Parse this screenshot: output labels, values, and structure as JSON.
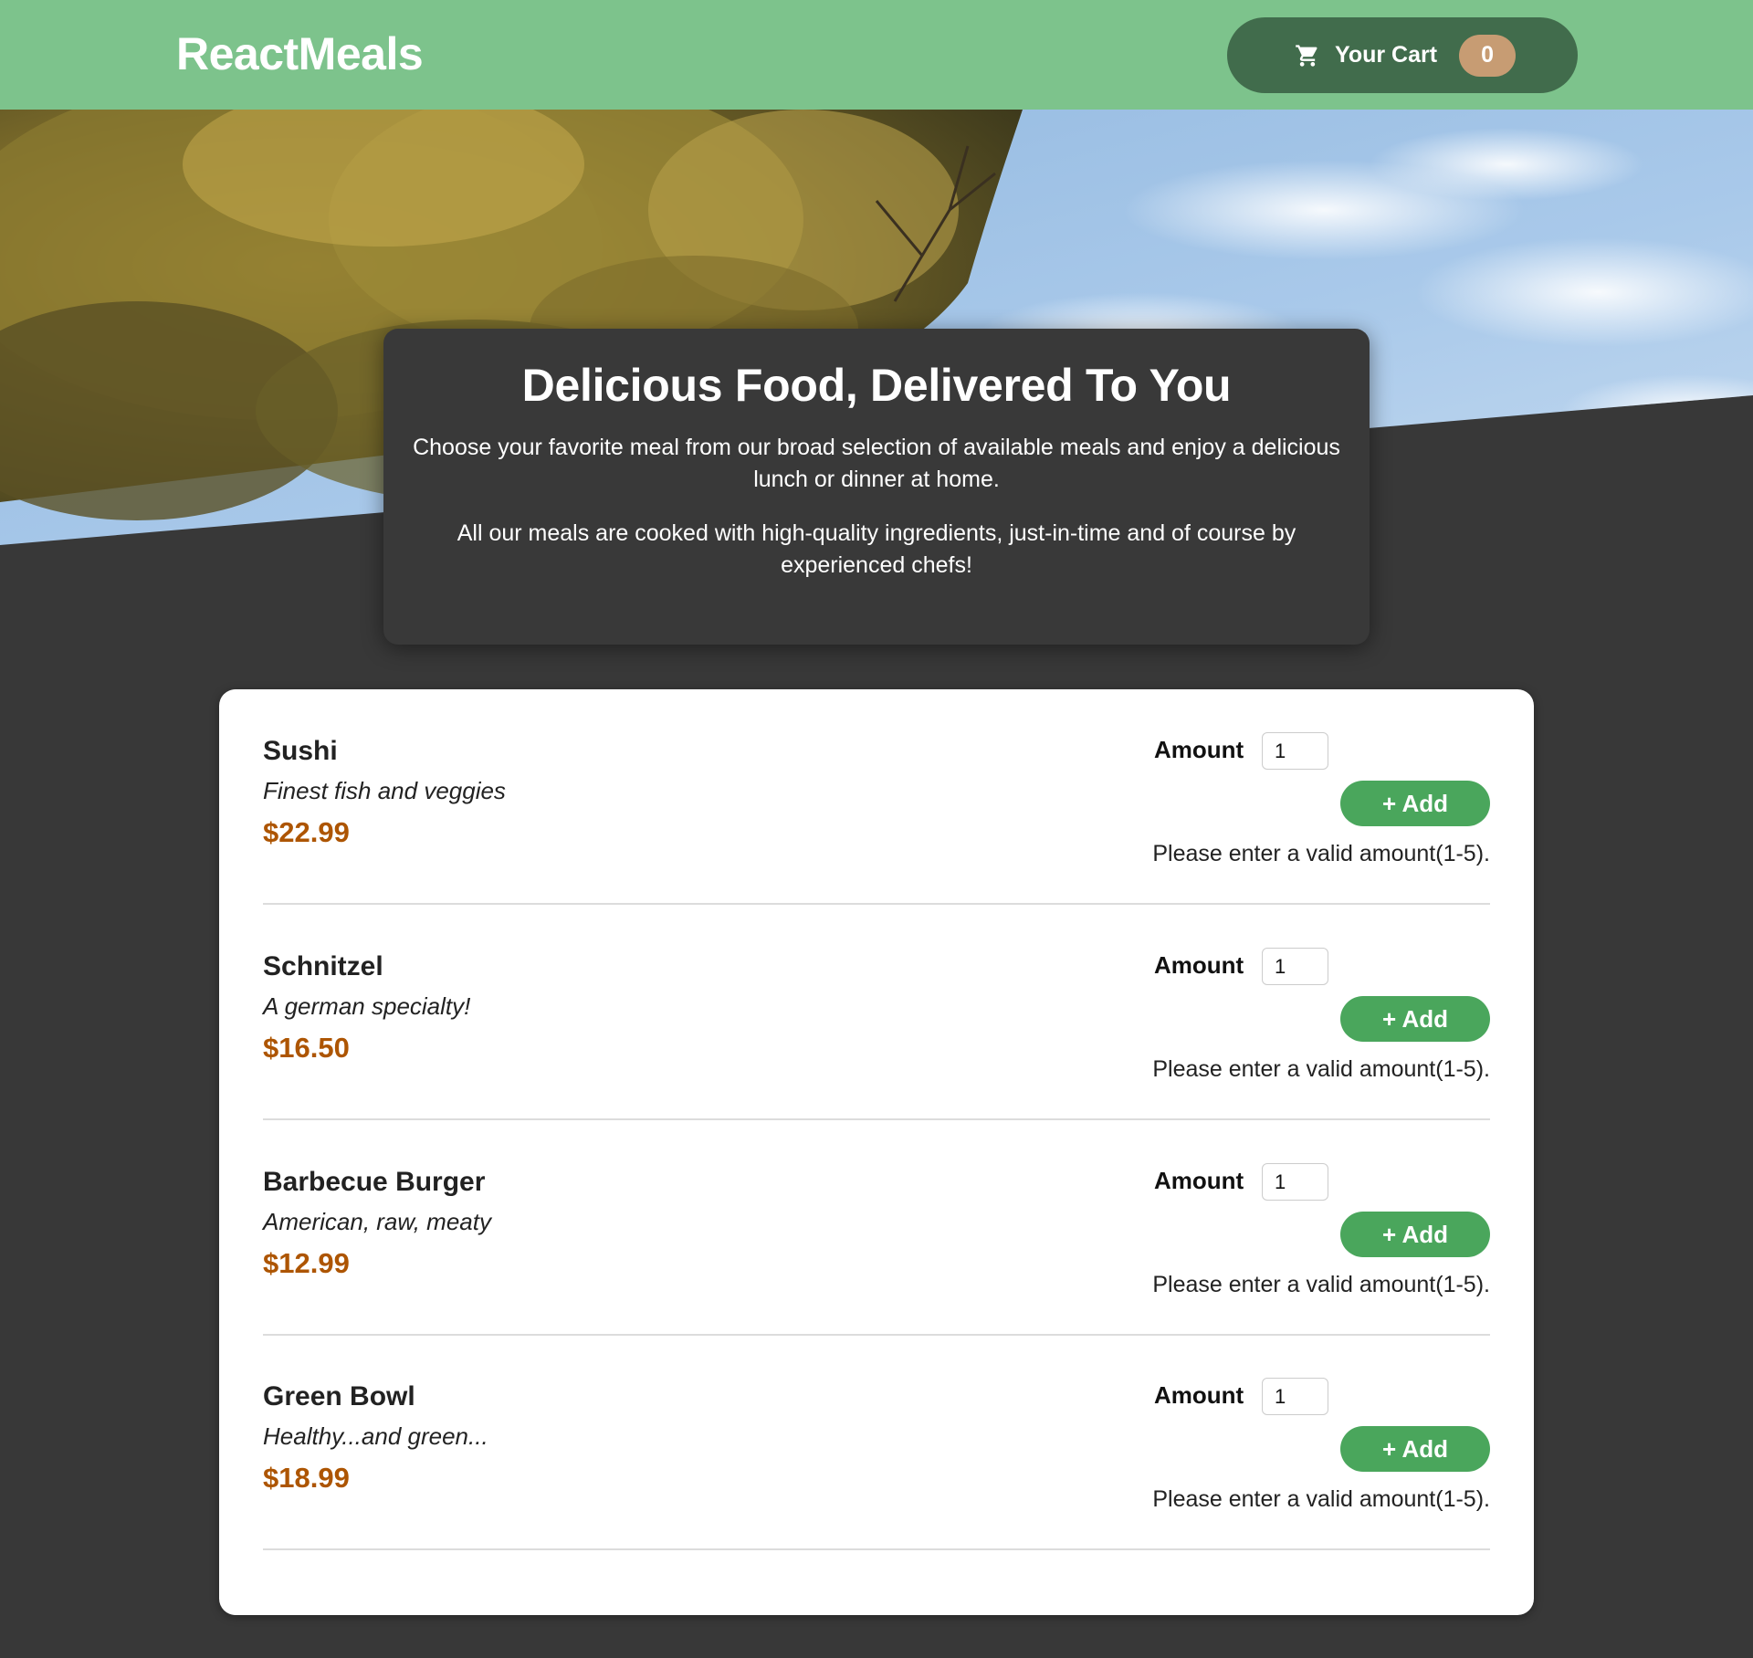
{
  "header": {
    "brand": "ReactMeals",
    "cart_label": "Your Cart",
    "cart_count": "0",
    "cart_icon": "shopping-cart-icon"
  },
  "summary": {
    "title": "Delicious Food, Delivered To You",
    "paragraph1": "Choose your favorite meal from our broad selection of available meals and enjoy a delicious lunch or dinner at home.",
    "paragraph2": "All our meals are cooked with high-quality ingredients, just-in-time and of course by experienced chefs!"
  },
  "meals": [
    {
      "name": "Sushi",
      "description": "Finest fish and veggies",
      "price": "$22.99",
      "amount_label": "Amount",
      "amount_value": "1",
      "add_label": "+ Add",
      "error": "Please enter a valid amount(1-5)."
    },
    {
      "name": "Schnitzel",
      "description": "A german specialty!",
      "price": "$16.50",
      "amount_label": "Amount",
      "amount_value": "1",
      "add_label": "+ Add",
      "error": "Please enter a valid amount(1-5)."
    },
    {
      "name": "Barbecue Burger",
      "description": "American, raw, meaty",
      "price": "$12.99",
      "amount_label": "Amount",
      "amount_value": "1",
      "add_label": "+ Add",
      "error": "Please enter a valid amount(1-5)."
    },
    {
      "name": "Green Bowl",
      "description": "Healthy...and green...",
      "price": "$18.99",
      "amount_label": "Amount",
      "amount_value": "1",
      "add_label": "+ Add",
      "error": "Please enter a valid amount(1-5)."
    }
  ],
  "colors": {
    "header_bg": "#7dc38c",
    "cart_button_bg": "#416c4c",
    "cart_badge_bg": "#c79c73",
    "page_bg": "#383838",
    "price": "#ad5502",
    "add_button": "#4aa65c"
  }
}
